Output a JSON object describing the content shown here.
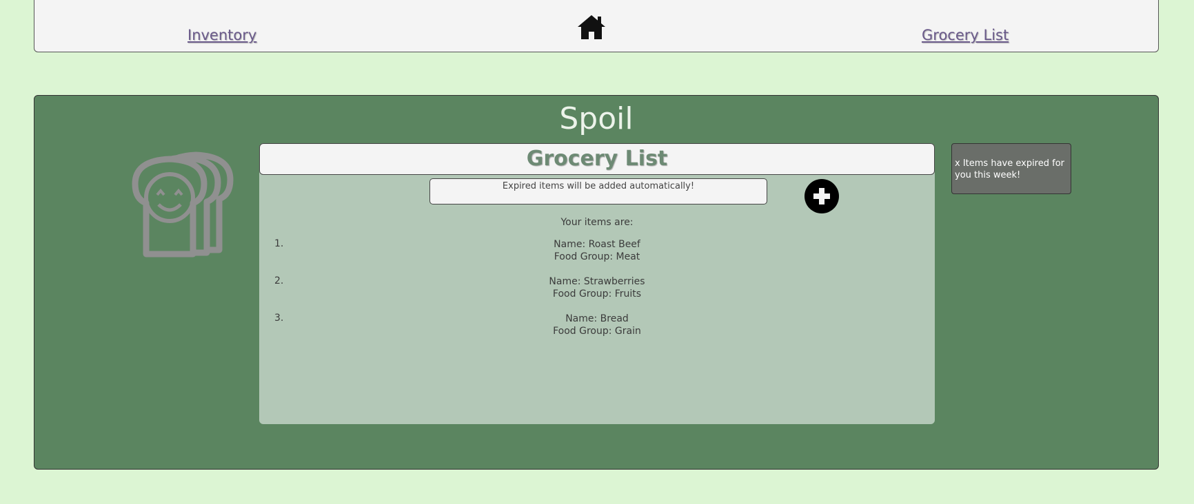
{
  "nav": {
    "inventory_label": "Inventory",
    "grocery_label": "Grocery List"
  },
  "app": {
    "title": "Spoil"
  },
  "grocery": {
    "title": "Grocery List",
    "notice": "Expired items will be added automatically!",
    "items_label": "Your items are:",
    "items": [
      {
        "number": "1.",
        "name": "Name: Roast Beef",
        "group": "Food Group: Meat"
      },
      {
        "number": "2.",
        "name": "Name: Strawberries",
        "group": "Food Group: Fruits"
      },
      {
        "number": "3.",
        "name": "Name: Bread",
        "group": "Food Group: Grain"
      }
    ]
  },
  "expired": {
    "text": "x Items have expired for you this week!"
  },
  "icons": {
    "home": "home-icon",
    "add": "plus-icon",
    "logo": "toast-logo"
  },
  "colors": {
    "background": "#dcf5d3",
    "panel": "#5b8560",
    "content": "#b3c8b7",
    "link": "#6a5a8a",
    "title_text": "#6d8a74"
  }
}
